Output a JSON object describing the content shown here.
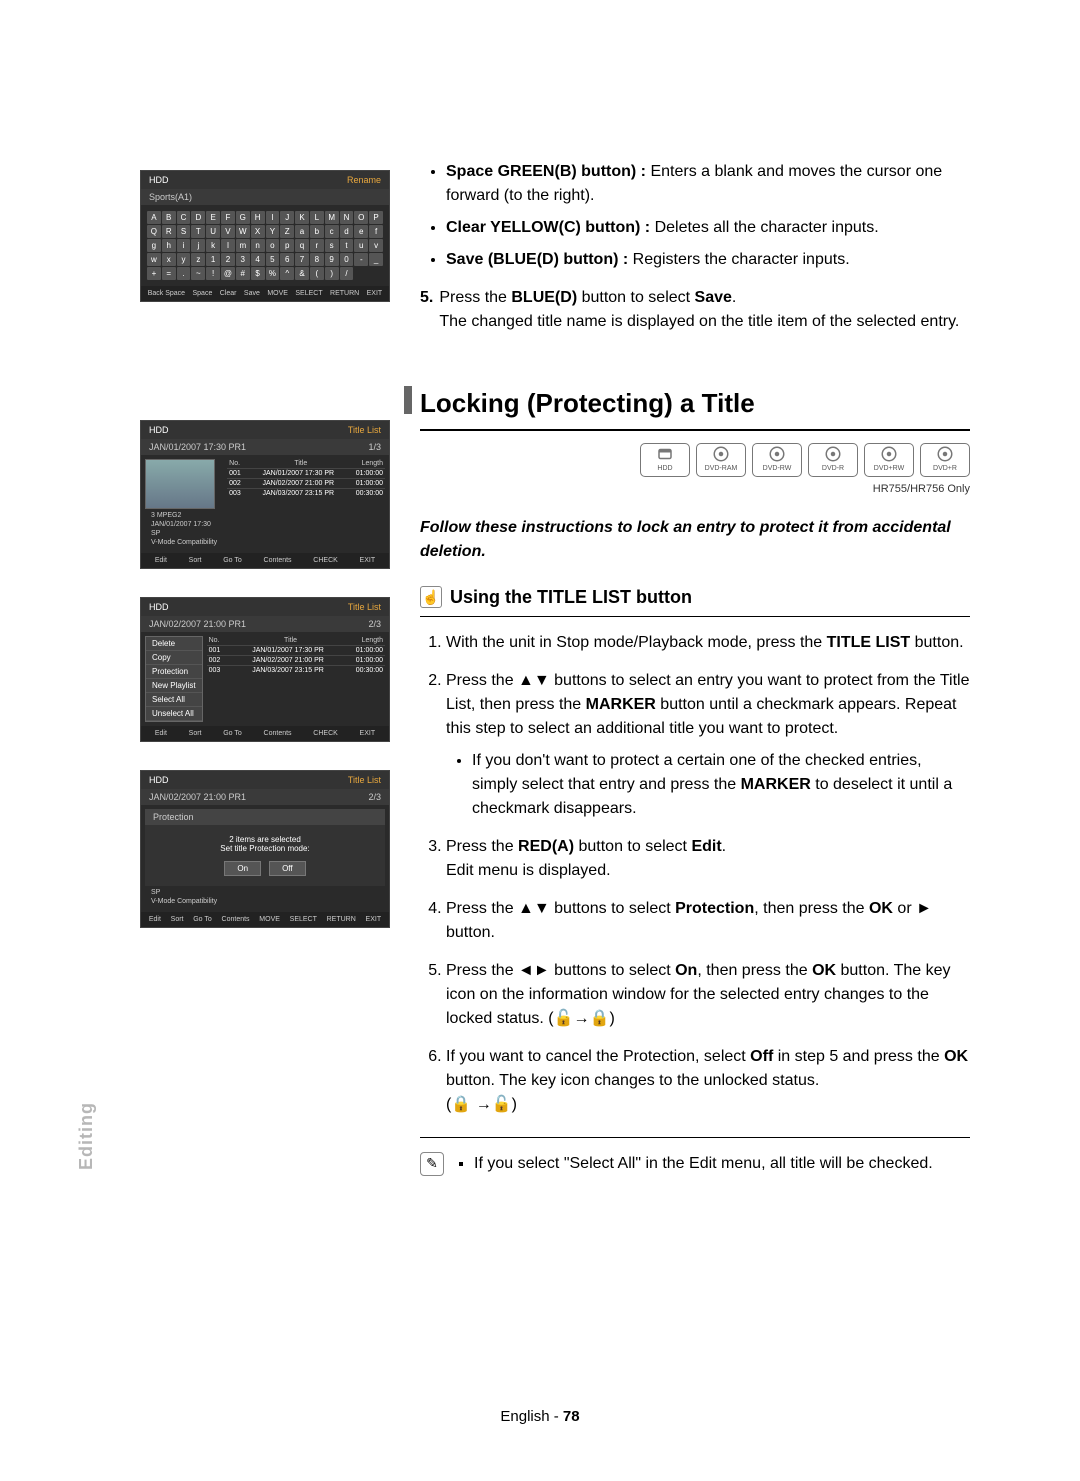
{
  "side_label": "Editing",
  "footer": {
    "lang": "English",
    "sep": " - ",
    "num": "78"
  },
  "top_bullets": [
    {
      "label": "Space GREEN(B) button) :",
      "text": " Enters a blank and moves the cursor one forward (to the right)."
    },
    {
      "label": "Clear YELLOW(C) button) :",
      "text": " Deletes all the character inputs."
    },
    {
      "label": "Save (BLUE(D) button) :",
      "text": " Registers the character inputs."
    }
  ],
  "step5": {
    "num": "5.",
    "line1a": "Press the ",
    "line1b": "BLUE(D)",
    "line1c": " button to select ",
    "line1d": "Save",
    "line1e": ".",
    "line2": "The changed title name is displayed on the title item of the selected entry."
  },
  "section_title": "Locking (Protecting) a Title",
  "discs": [
    "HDD",
    "DVD-RAM",
    "DVD-RW",
    "DVD-R",
    "DVD+RW",
    "DVD+R"
  ],
  "model_note": "HR755/HR756 Only",
  "instruction": "Follow these instructions to lock an entry to protect it from accidental deletion.",
  "subsection": {
    "title": "Using the TITLE LIST button"
  },
  "steps": [
    {
      "p1": "With the unit in Stop mode/Playback mode, press the ",
      "b1": "TITLE LIST",
      "p2": " button."
    },
    {
      "p1": "Press the ▲▼ buttons to select an entry you want to protect from the Title List, then press the ",
      "b1": "MARKER",
      "p2": " button until a checkmark appears. Repeat this step to select an additional title you want to protect.",
      "sub": {
        "p1": "If you don't want to protect a certain one of the checked entries, simply select that entry and press the ",
        "b1": "MARKER",
        "p2": " to deselect it until a checkmark disappears."
      }
    },
    {
      "p1": "Press the ",
      "b1": "RED(A)",
      "p2": " button to select ",
      "b2": "Edit",
      "p3": ".",
      "line2": "Edit menu is displayed."
    },
    {
      "p1": "Press the ▲▼ buttons to select ",
      "b1": "Protection",
      "p2": ", then press the ",
      "b2": "OK",
      "p3": " or ► button."
    },
    {
      "p1": "Press the ◄► buttons to select ",
      "b1": "On",
      "p2": ", then press the ",
      "b2": "OK",
      "p3": " button. The key icon on the information window for the selected entry changes to the locked status. (🔓→🔒)"
    },
    {
      "p1": "If you want to cancel the Protection, select ",
      "b1": "Off",
      "p2": " in step 5 and press the ",
      "b2": "OK",
      "p3": " button. The key icon changes to the unlocked status.",
      "line2": "(🔒 →🔓)"
    }
  ],
  "note": "If you select \"Select All\" in the Edit menu, all title will be checked.",
  "ui1": {
    "hdd": "HDD",
    "action": "Rename",
    "input": "Sports(A1)",
    "keys": [
      "A",
      "B",
      "C",
      "D",
      "E",
      "F",
      "G",
      "H",
      "I",
      "J",
      "K",
      "L",
      "M",
      "N",
      "O",
      "P",
      "Q",
      "R",
      "S",
      "T",
      "U",
      "V",
      "W",
      "X",
      "Y",
      "Z",
      "a",
      "b",
      "c",
      "d",
      "e",
      "f",
      "g",
      "h",
      "i",
      "j",
      "k",
      "l",
      "m",
      "n",
      "o",
      "p",
      "q",
      "r",
      "s",
      "t",
      "u",
      "v",
      "w",
      "x",
      "y",
      "z",
      "1",
      "2",
      "3",
      "4",
      "5",
      "6",
      "7",
      "8",
      "9",
      "0",
      "-",
      "_",
      "+",
      "=",
      ".",
      "~",
      "!",
      "@",
      "#",
      "$",
      "%",
      "^",
      "&",
      "(",
      ")",
      "/"
    ],
    "footer": [
      "Back Space",
      "Space",
      "Clear",
      "Save",
      "MOVE",
      "SELECT",
      "RETURN",
      "EXIT"
    ]
  },
  "ui2": {
    "hdd": "HDD",
    "label": "Title List",
    "sub": "JAN/01/2007 17:30 PR1",
    "count": "1/3",
    "cols": [
      "No.",
      "Title",
      "Length"
    ],
    "rows": [
      [
        "001",
        "JAN/01/2007 17:30 PR",
        "01:00:00"
      ],
      [
        "002",
        "JAN/02/2007 21:00 PR",
        "01:00:00"
      ],
      [
        "003",
        "JAN/03/2007 23:15 PR",
        "00:30:00"
      ]
    ],
    "info": [
      "3 MPEG2",
      "JAN/01/2007 17:30",
      "SP",
      "V-Mode Compatibility"
    ],
    "footer": [
      "Edit",
      "Sort",
      "Go To",
      "Contents",
      "CHECK",
      "EXIT"
    ]
  },
  "ui3": {
    "hdd": "HDD",
    "label": "Title List",
    "sub": "JAN/02/2007 21:00 PR1",
    "count": "2/3",
    "menu": [
      "Delete",
      "Copy",
      "Protection",
      "New Playlist",
      "Select All",
      "Unselect All"
    ],
    "cols": [
      "No.",
      "Title",
      "Length"
    ],
    "rows": [
      [
        "001",
        "JAN/01/2007 17:30 PR",
        "01:00:00"
      ],
      [
        "002",
        "JAN/02/2007 21:00 PR",
        "01:00:00"
      ],
      [
        "003",
        "JAN/03/2007 23:15 PR",
        "00:30:00"
      ]
    ],
    "footer": [
      "Edit",
      "Sort",
      "Go To",
      "Contents",
      "CHECK",
      "EXIT"
    ]
  },
  "ui4": {
    "hdd": "HDD",
    "label": "Title List",
    "sub": "JAN/02/2007 21:00 PR1",
    "count": "2/3",
    "dlg_title": "Protection",
    "dlg_l1": "2 items are selected",
    "dlg_l2": "Set title Protection mode:",
    "on": "On",
    "off": "Off",
    "info": [
      "SP",
      "V-Mode Compatibility"
    ],
    "footer": [
      "Edit",
      "Sort",
      "Go To",
      "Contents",
      "MOVE",
      "SELECT",
      "RETURN",
      "EXIT"
    ]
  }
}
